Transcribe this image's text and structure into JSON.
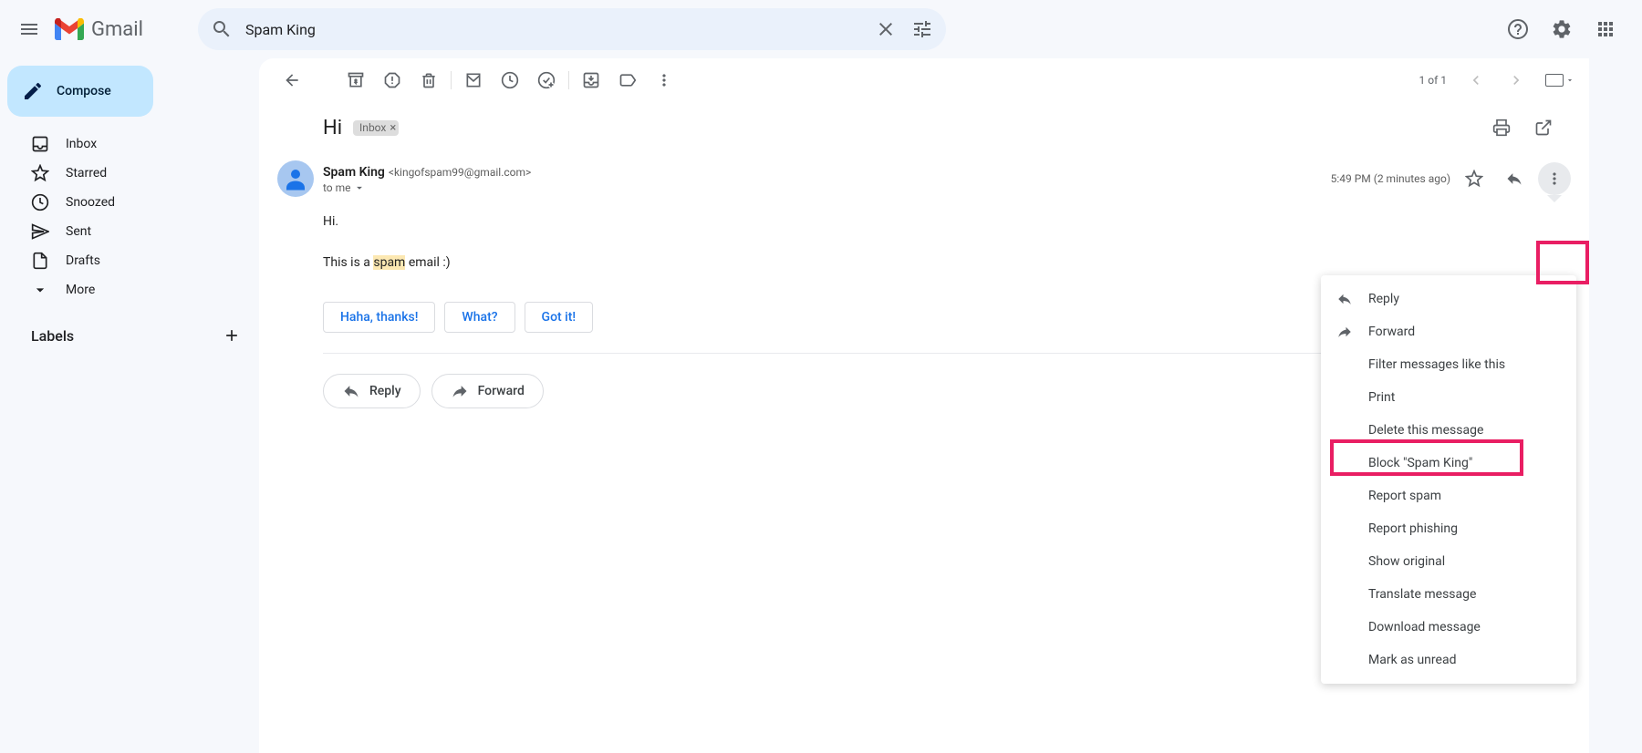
{
  "header": {
    "app_name": "Gmail",
    "search_value": "Spam King"
  },
  "sidebar": {
    "compose": "Compose",
    "items": [
      {
        "label": "Inbox"
      },
      {
        "label": "Starred"
      },
      {
        "label": "Snoozed"
      },
      {
        "label": "Sent"
      },
      {
        "label": "Drafts"
      },
      {
        "label": "More"
      }
    ],
    "labels_header": "Labels"
  },
  "toolbar": {
    "page_indicator": "1 of 1"
  },
  "email": {
    "subject": "Hi",
    "inbox_chip": "Inbox",
    "sender_name": "Spam King",
    "sender_email": "<kingofspam99@gmail.com>",
    "to_line": "to me",
    "timestamp": "5:49 PM (2 minutes ago)",
    "body_line1": "Hi.",
    "body_line2_pre": "This is a ",
    "body_line2_highlight": "spam",
    "body_line2_post": " email :)",
    "smart_replies": [
      "Haha, thanks!",
      "What?",
      "Got it!"
    ],
    "reply_btn": "Reply",
    "forward_btn": "Forward"
  },
  "menu": {
    "reply": "Reply",
    "forward": "Forward",
    "filter": "Filter messages like this",
    "print": "Print",
    "delete": "Delete this message",
    "block": "Block \"Spam King\"",
    "report_spam": "Report spam",
    "report_phishing": "Report phishing",
    "show_original": "Show original",
    "translate": "Translate message",
    "download": "Download message",
    "mark_unread": "Mark as unread"
  }
}
